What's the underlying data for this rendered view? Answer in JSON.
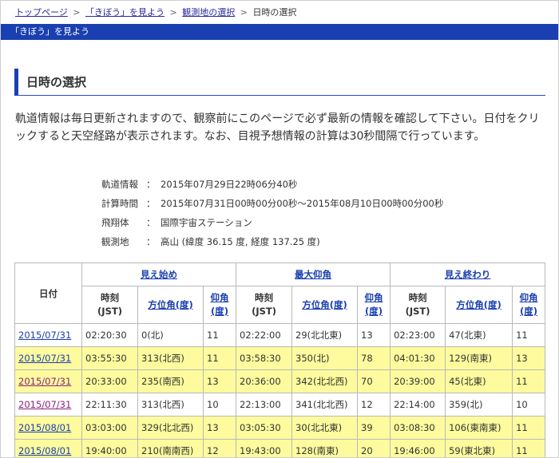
{
  "breadcrumb": {
    "items": [
      "トップページ",
      "「きぼう」を見よう",
      "観測地の選択"
    ],
    "separator": ">",
    "current": "日時の選択"
  },
  "title_bar": "「きぼう」を見よう",
  "heading": "日時の選択",
  "intro": "軌道情報は毎日更新されますので、観察前にこのページで必ず最新の情報を確認して下さい。日付をクリックすると天空経路が表示されます。なお、目視予想情報の計算は30秒間隔で行っています。",
  "info": {
    "colon": "：",
    "rows": [
      {
        "label": "軌道情報",
        "value": "2015年07月29日22時06分40秒"
      },
      {
        "label": "計算時間",
        "value": "2015年07月31日00時00分00秒～2015年08月10日00時00分00秒"
      },
      {
        "label": "飛翔体",
        "value": "国際宇宙ステーション"
      },
      {
        "label": "観測地",
        "value": "高山 (緯度 36.15 度, 経度 137.25 度)"
      }
    ]
  },
  "table": {
    "date_header": "日付",
    "groups": [
      "見え始め",
      "最大仰角",
      "見え終わり"
    ],
    "sub": {
      "time_a": "時刻",
      "time_b": "(JST)",
      "azimuth": "方位角(度)",
      "elev_a": "仰角",
      "elev_b": "(度)"
    },
    "rows": [
      {
        "date": "2015/07/31",
        "visited": false,
        "highlight": false,
        "start": {
          "time": "02:20:30",
          "az": "0(北)",
          "el": "11"
        },
        "max": {
          "time": "02:22:00",
          "az": "29(北北東)",
          "el": "13"
        },
        "end": {
          "time": "02:23:00",
          "az": "47(北東)",
          "el": "11"
        }
      },
      {
        "date": "2015/07/31",
        "visited": false,
        "highlight": true,
        "start": {
          "time": "03:55:30",
          "az": "313(北西)",
          "el": "11"
        },
        "max": {
          "time": "03:58:30",
          "az": "350(北)",
          "el": "78"
        },
        "end": {
          "time": "04:01:30",
          "az": "129(南東)",
          "el": "13"
        }
      },
      {
        "date": "2015/07/31",
        "visited": true,
        "highlight": true,
        "start": {
          "time": "20:33:00",
          "az": "235(南西)",
          "el": "13"
        },
        "max": {
          "time": "20:36:00",
          "az": "342(北北西)",
          "el": "70"
        },
        "end": {
          "time": "20:39:00",
          "az": "45(北東)",
          "el": "11"
        }
      },
      {
        "date": "2015/07/31",
        "visited": true,
        "highlight": false,
        "start": {
          "time": "22:11:30",
          "az": "313(北西)",
          "el": "10"
        },
        "max": {
          "time": "22:13:00",
          "az": "341(北北西)",
          "el": "12"
        },
        "end": {
          "time": "22:14:00",
          "az": "359(北)",
          "el": "10"
        }
      },
      {
        "date": "2015/08/01",
        "visited": false,
        "highlight": true,
        "start": {
          "time": "03:03:00",
          "az": "329(北北西)",
          "el": "13"
        },
        "max": {
          "time": "03:05:30",
          "az": "30(北北東)",
          "el": "39"
        },
        "end": {
          "time": "03:08:30",
          "az": "106(東南東)",
          "el": "11"
        }
      },
      {
        "date": "2015/08/01",
        "visited": false,
        "highlight": true,
        "start": {
          "time": "19:40:00",
          "az": "210(南南西)",
          "el": "12"
        },
        "max": {
          "time": "19:43:00",
          "az": "128(南東)",
          "el": "20"
        },
        "end": {
          "time": "19:46:00",
          "az": "59(東北東)",
          "el": "11"
        }
      }
    ]
  }
}
